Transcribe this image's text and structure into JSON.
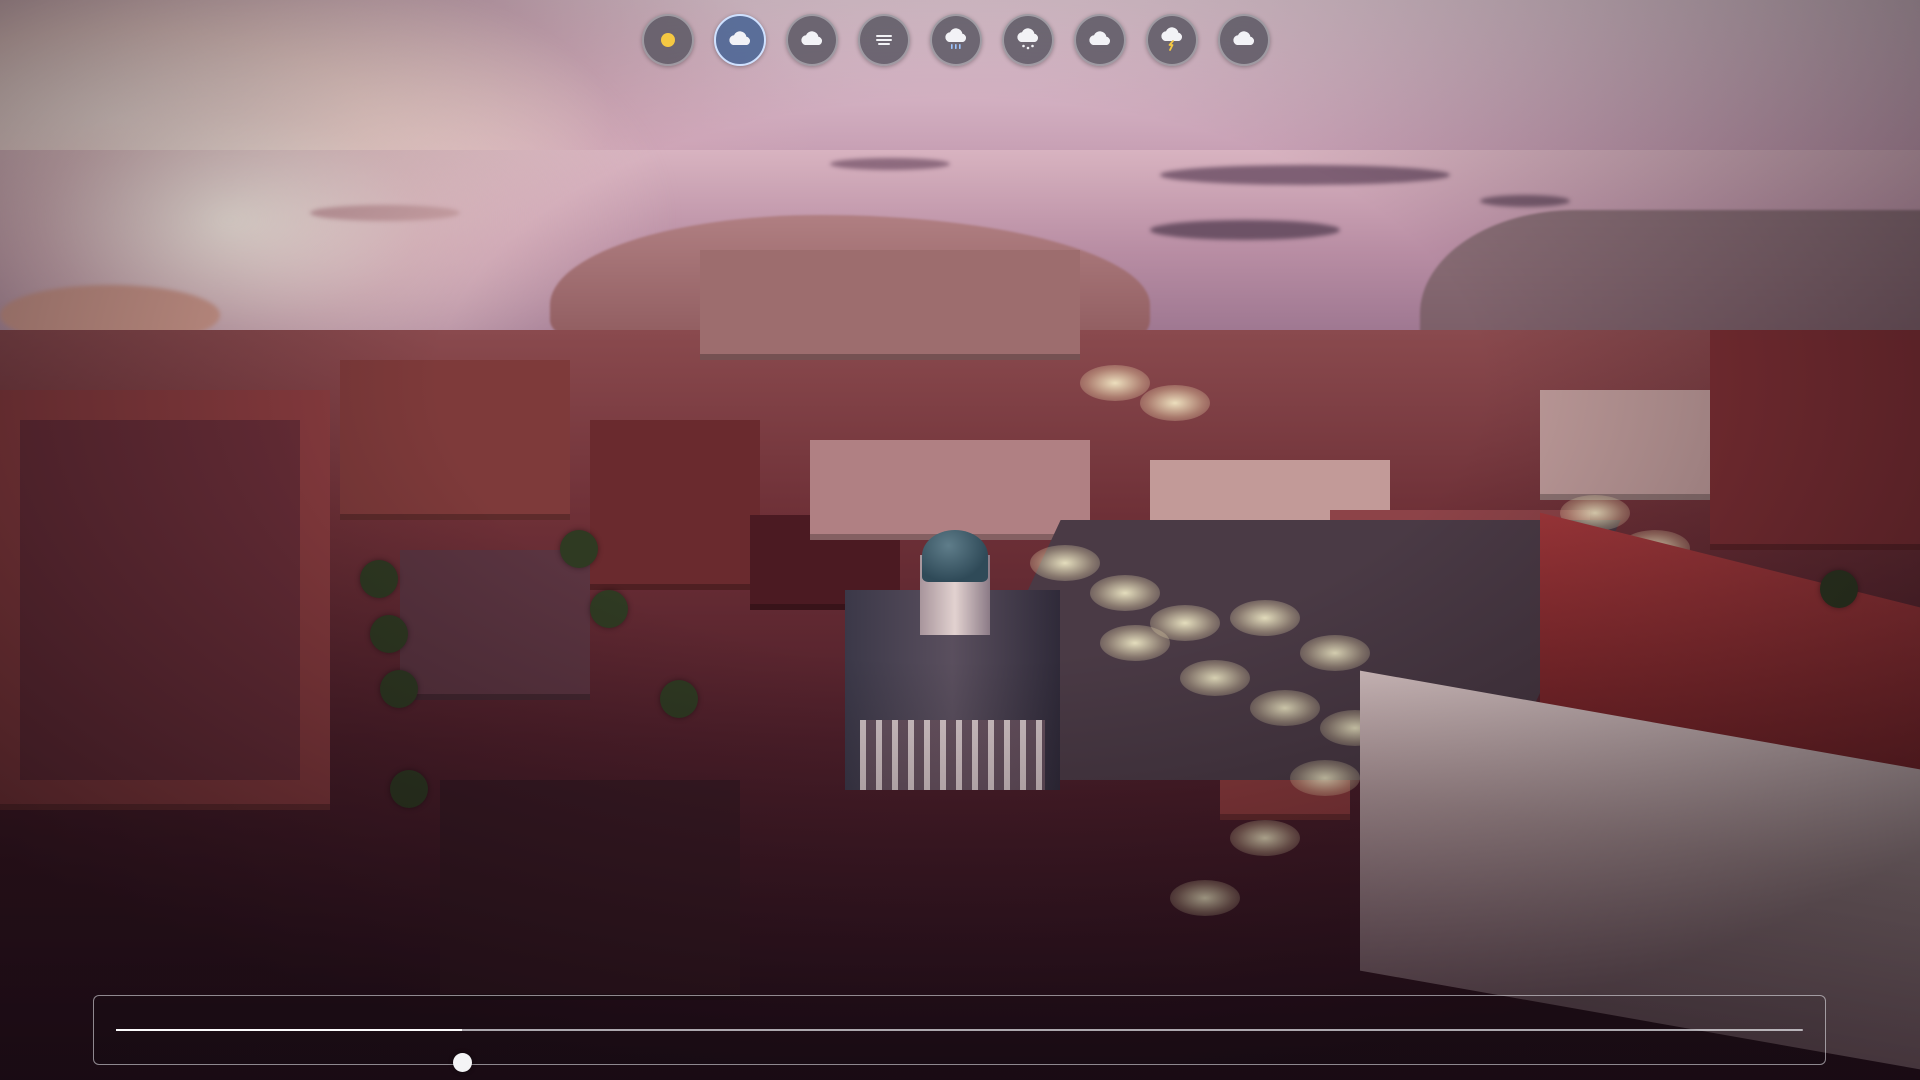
{
  "weather_toolbar": {
    "selected_index": 1,
    "buttons": [
      {
        "icon": "sun-icon",
        "state": "clear"
      },
      {
        "icon": "cloud-sun-icon",
        "state": "partly-cloudy"
      },
      {
        "icon": "cloud-icon",
        "state": "cloudy"
      },
      {
        "icon": "fog-icon",
        "state": "fog"
      },
      {
        "icon": "cloud-rain-icon",
        "state": "rain"
      },
      {
        "icon": "cloud-snow-icon",
        "state": "snow"
      },
      {
        "icon": "cloud-overcast-icon",
        "state": "overcast"
      },
      {
        "icon": "cloud-lightning-icon",
        "state": "thunderstorm"
      },
      {
        "icon": "cloud-dark-icon",
        "state": "storm"
      }
    ],
    "colors": {
      "sun": "#f5c842",
      "lightning": "#f5c842",
      "cloud": "#f2f2f6",
      "rain": "#9cc4ff"
    }
  },
  "timeline": {
    "value_fraction": 0.205
  }
}
